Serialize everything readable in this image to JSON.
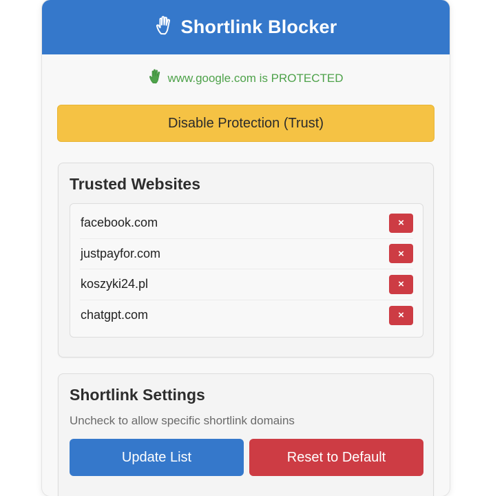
{
  "header": {
    "title": "Shortlink Blocker",
    "icon": "raised-hand-icon",
    "background": "#3578cb"
  },
  "status": {
    "text": "www.google.com is PROTECTED",
    "icon": "raised-hand-icon",
    "color": "#4ea24a"
  },
  "protection_button": {
    "label": "Disable Protection (Trust)",
    "color": "#f5c244"
  },
  "trusted": {
    "title": "Trusted Websites",
    "sites": [
      {
        "name": "facebook.com",
        "remove_label": "×"
      },
      {
        "name": "justpayfor.com",
        "remove_label": "×"
      },
      {
        "name": "koszyki24.pl",
        "remove_label": "×"
      },
      {
        "name": "chatgpt.com",
        "remove_label": "×"
      }
    ]
  },
  "settings": {
    "title": "Shortlink Settings",
    "description": "Uncheck to allow specific shortlink domains",
    "update_label": "Update List",
    "reset_label": "Reset to Default",
    "update_color": "#3578cb",
    "reset_color": "#cd3c44"
  }
}
